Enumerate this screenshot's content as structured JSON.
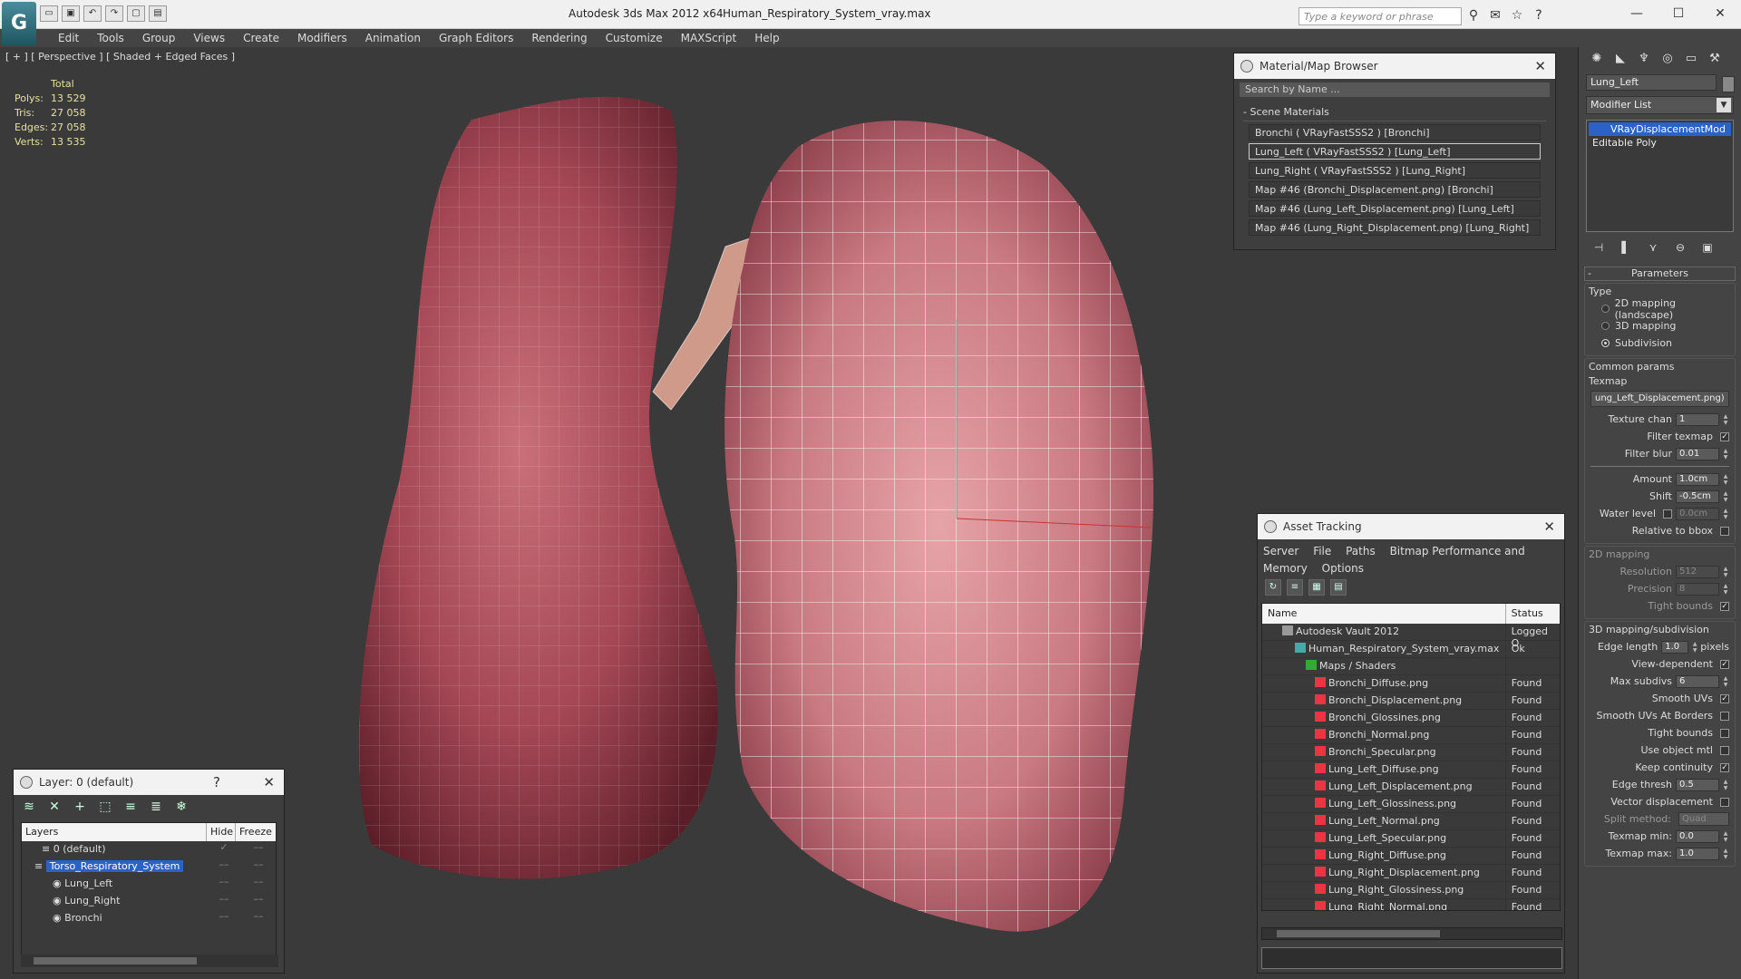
{
  "window": {
    "app_title": "Autodesk 3ds Max  2012 x64",
    "file_name": "Human_Respiratory_System_vray.max",
    "search_placeholder": "Type a keyword or phrase"
  },
  "menu": [
    "Edit",
    "Tools",
    "Group",
    "Views",
    "Create",
    "Modifiers",
    "Animation",
    "Graph Editors",
    "Rendering",
    "Customize",
    "MAXScript",
    "Help"
  ],
  "viewport": {
    "label": "[ + ] [ Perspective ] [ Shaded + Edged Faces ]",
    "stats": {
      "header": "Total",
      "rows": [
        {
          "k": "Polys:",
          "v": "13 529"
        },
        {
          "k": "Tris:",
          "v": "27 058"
        },
        {
          "k": "Edges:",
          "v": "27 058"
        },
        {
          "k": "Verts:",
          "v": "13 535"
        }
      ]
    }
  },
  "material_browser": {
    "title": "Material/Map Browser",
    "search": "Search by Name ...",
    "section": "- Scene Materials",
    "items": [
      "Bronchi  ( VRayFastSSS2 )  [Bronchi]",
      "Lung_Left  ( VRayFastSSS2 )  [Lung_Left]",
      "Lung_Right  ( VRayFastSSS2 )  [Lung_Right]",
      "Map #46 (Bronchi_Displacement.png)  [Bronchi]",
      "Map #46 (Lung_Left_Displacement.png)  [Lung_Left]",
      "Map #46 (Lung_Right_Displacement.png)  [Lung_Right]"
    ]
  },
  "asset_tracking": {
    "title": "Asset Tracking",
    "menu": [
      "Server",
      "File",
      "Paths",
      "Bitmap Performance and Memory",
      "Options"
    ],
    "col_name": "Name",
    "col_status": "Status",
    "rows": [
      {
        "name": "Autodesk Vault 2012",
        "status": "Logged O"
      },
      {
        "name": "Human_Respiratory_System_vray.max",
        "status": "Ok"
      },
      {
        "name": "Maps / Shaders",
        "status": ""
      },
      {
        "name": "Bronchi_Diffuse.png",
        "status": "Found"
      },
      {
        "name": "Bronchi_Displacement.png",
        "status": "Found"
      },
      {
        "name": "Bronchi_Glossines.png",
        "status": "Found"
      },
      {
        "name": "Bronchi_Normal.png",
        "status": "Found"
      },
      {
        "name": "Bronchi_Specular.png",
        "status": "Found"
      },
      {
        "name": "Lung_Left_Diffuse.png",
        "status": "Found"
      },
      {
        "name": "Lung_Left_Displacement.png",
        "status": "Found"
      },
      {
        "name": "Lung_Left_Glossiness.png",
        "status": "Found"
      },
      {
        "name": "Lung_Left_Normal.png",
        "status": "Found"
      },
      {
        "name": "Lung_Left_Specular.png",
        "status": "Found"
      },
      {
        "name": "Lung_Right_Diffuse.png",
        "status": "Found"
      },
      {
        "name": "Lung_Right_Displacement.png",
        "status": "Found"
      },
      {
        "name": "Lung_Right_Glossiness.png",
        "status": "Found"
      },
      {
        "name": "Lung_Right_Normal.png",
        "status": "Found"
      }
    ]
  },
  "layer_panel": {
    "title": "Layer: 0 (default)",
    "help": "?",
    "col_layers": "Layers",
    "col_hide": "Hide",
    "col_freeze": "Freeze",
    "rows": [
      {
        "name": "0 (default)"
      },
      {
        "name": "Torso_Respiratory_System"
      },
      {
        "name": "Lung_Left"
      },
      {
        "name": "Lung_Right"
      },
      {
        "name": "Bronchi"
      }
    ]
  },
  "command_panel": {
    "object_name": "Lung_Left",
    "modifier_list": "Modifier List",
    "stack": [
      "VRayDisplacementMod",
      "Editable Poly"
    ],
    "parameters_title": "Parameters",
    "type_label": "Type",
    "type_options": [
      "2D mapping (landscape)",
      "3D mapping",
      "Subdivision"
    ],
    "common_params": "Common params",
    "texmap_label": "Texmap",
    "texmap_value": "ung_Left_Displacement.png)",
    "texture_chan_label": "Texture chan",
    "texture_chan": "1",
    "filter_texmap": "Filter texmap",
    "filter_blur_label": "Filter blur",
    "filter_blur": "0.01",
    "amount_label": "Amount",
    "amount": "1.0cm",
    "shift_label": "Shift",
    "shift": "-0.5cm",
    "water_level_label": "Water level",
    "water_level": "0.0cm",
    "relative_bbox": "Relative to bbox",
    "mapping_2d": "2D mapping",
    "resolution_label": "Resolution",
    "resolution": "512",
    "precision_label": "Precision",
    "precision": "8",
    "tight_bounds_2d": "Tight bounds",
    "mapping_3d": "3D mapping/subdivision",
    "edge_length_label": "Edge length",
    "edge_length": "1.0",
    "pixels": "pixels",
    "view_dependent": "View-dependent",
    "max_subdivs_label": "Max subdivs",
    "max_subdivs": "6",
    "smooth_uvs": "Smooth UVs",
    "smooth_uvs_borders": "Smooth UVs At Borders",
    "tight_bounds_3d": "Tight bounds",
    "use_object_mtl": "Use object mtl",
    "keep_continuity": "Keep continuity",
    "edge_thresh_label": "Edge thresh",
    "edge_thresh": "0.5",
    "vector_displacement": "Vector displacement",
    "split_method_label": "Split method:",
    "split_method": "Quad",
    "texmap_min_label": "Texmap min:",
    "texmap_min": "0.0",
    "texmap_max_label": "Texmap max:",
    "texmap_max": "1.0"
  }
}
